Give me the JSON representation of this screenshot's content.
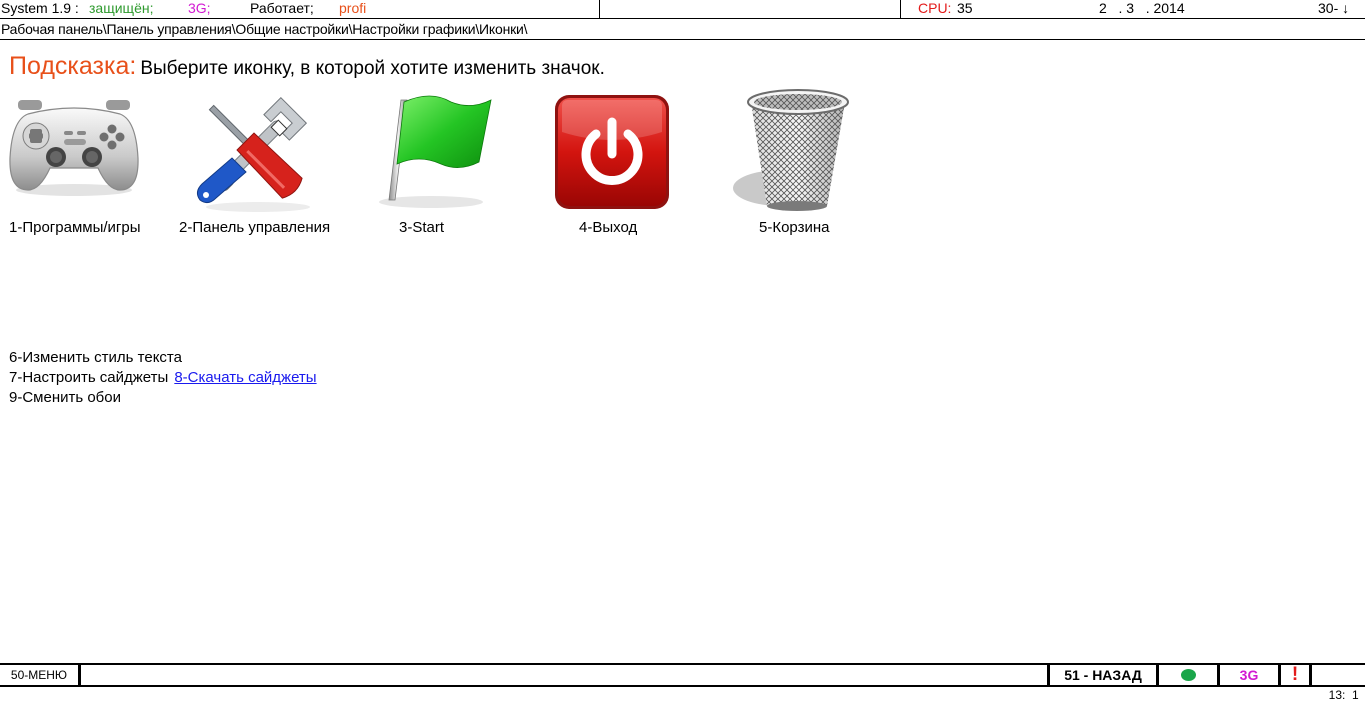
{
  "status": {
    "system": "System 1.9 :",
    "protected": "защищён;",
    "network": "3G;",
    "works": "Работает;",
    "profile": "profi",
    "cpu_label": "CPU:",
    "cpu_value": "35",
    "date": "2   . 3   . 2014",
    "right": "30- ↓",
    "colors": {
      "protected": "#2e9a2e",
      "network": "#d21ad2",
      "profile": "#e8501a",
      "cpu_label": "#e31b1b"
    }
  },
  "breadcrumb": "Рабочая панель\\Панель управления\\Общие настройки\\Настройки графики\\Иконки\\",
  "hint": {
    "label": "Подсказка:",
    "text": "Выберите иконку, в которой хотите изменить значок.",
    "label_color": "#e8501a"
  },
  "icons": [
    {
      "label": "1-Программы/игры",
      "icon": "gamepad-icon"
    },
    {
      "label": "2-Панель управления",
      "icon": "tools-icon"
    },
    {
      "label": "3-Start",
      "icon": "green-flag-icon"
    },
    {
      "label": "4-Выход",
      "icon": "power-button-icon"
    },
    {
      "label": "5-Корзина",
      "icon": "trash-bin-icon"
    }
  ],
  "menu": {
    "item6": "6-Изменить стиль текста",
    "item7": "7-Настроить сайджеты",
    "item8": "8-Скачать сайджеты",
    "item9": "9-Сменить обои"
  },
  "bottom": {
    "menu": "50-МЕНЮ",
    "back": "51 - НАЗАД",
    "network": "3G",
    "alert": "!",
    "time": "13:  1",
    "colors": {
      "indicator": "#1aa64a",
      "network": "#d21ad2",
      "alert": "#e31b1b"
    }
  }
}
